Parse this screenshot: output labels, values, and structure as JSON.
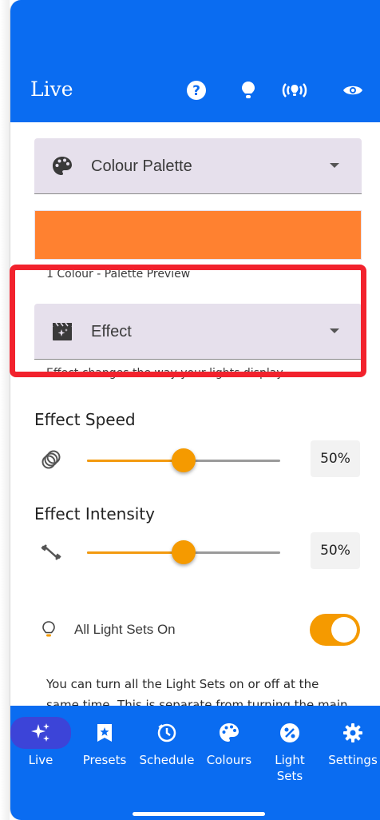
{
  "header": {
    "title": "Live",
    "icons": [
      "help-icon",
      "bulb-icon",
      "broadcast-icon",
      "eye-icon"
    ]
  },
  "palette_select": {
    "label": "Colour Palette",
    "icon": "palette-icon"
  },
  "palette_preview": {
    "color": "#ff8130",
    "caption": "1 Colour - Palette Preview"
  },
  "effect_select": {
    "label": "Effect",
    "icon": "effect-icon",
    "helper": "Effect changes the way your lights display."
  },
  "effect_speed": {
    "title": "Effect Speed",
    "value": 50,
    "value_label": "50%",
    "icon": "speed-icon"
  },
  "effect_intensity": {
    "title": "Effect Intensity",
    "value": 50,
    "value_label": "50%",
    "icon": "intensity-icon"
  },
  "all_light_sets": {
    "label": "All Light Sets On",
    "on": true,
    "info": "You can turn all the Light Sets on or off at the same time. This is separate from turning the main"
  },
  "nav": {
    "items": [
      {
        "label": "Live",
        "icon": "sparkles-icon",
        "active": true
      },
      {
        "label": "Presets",
        "icon": "bookmark-star-icon",
        "active": false
      },
      {
        "label": "Schedule",
        "icon": "clock-icon",
        "active": false
      },
      {
        "label": "Colours",
        "icon": "palette-icon",
        "active": false
      },
      {
        "label": "Light Sets",
        "icon": "light-sets-icon",
        "active": false
      },
      {
        "label": "Settings",
        "icon": "gear-icon",
        "active": false
      }
    ]
  },
  "colors": {
    "primary": "#0a6cf1",
    "accent": "#f59a00",
    "highlight": "#f2222d",
    "select_bg": "#e6e0ec"
  }
}
